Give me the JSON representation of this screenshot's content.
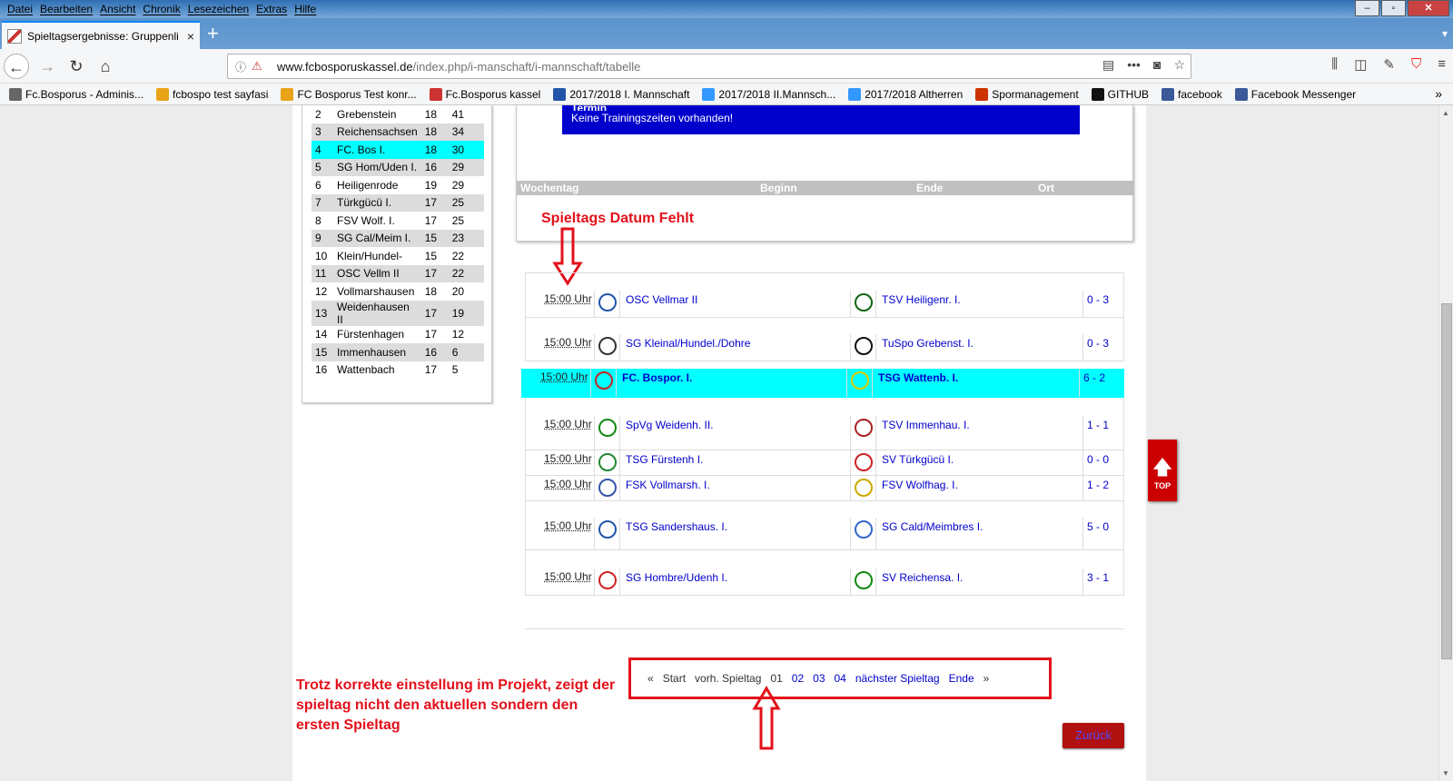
{
  "menubar": {
    "items": [
      "Datei",
      "Bearbeiten",
      "Ansicht",
      "Chronik",
      "Lesezeichen",
      "Extras",
      "Hilfe"
    ]
  },
  "tab": {
    "title": "Spieltagsergebnisse: Gruppenli",
    "close": "×",
    "new": "+"
  },
  "navbar": {
    "url_host": "www.fcbosporuskassel.de",
    "url_path": "/index.php/i-manschaft/i-mannschaft/tabelle"
  },
  "bookmarks": [
    {
      "label": "Fc.Bosporus - Adminis...",
      "color": "#666666"
    },
    {
      "label": "fcbospo test sayfasi",
      "color": "#e8a317"
    },
    {
      "label": "FC Bosporus Test konr...",
      "color": "#e8a317"
    },
    {
      "label": "Fc.Bosporus kassel",
      "color": "#cc3333"
    },
    {
      "label": "2017/2018 I. Mannschaft",
      "color": "#2255aa"
    },
    {
      "label": "2017/2018 II.Mannsch...",
      "color": "#3399ff"
    },
    {
      "label": "2017/2018 Altherren",
      "color": "#3399ff"
    },
    {
      "label": "Spormanagement",
      "color": "#cc3300"
    },
    {
      "label": "GITHUB",
      "color": "#111111"
    },
    {
      "label": "facebook",
      "color": "#3b5998"
    },
    {
      "label": "Facebook Messenger",
      "color": "#3b5998"
    }
  ],
  "standings": [
    {
      "rank": "2",
      "team": "Grebenstein",
      "games": "18",
      "points": "41"
    },
    {
      "rank": "3",
      "team": "Reichensachsen",
      "games": "18",
      "points": "34"
    },
    {
      "rank": "4",
      "team": "FC. Bos I.",
      "games": "18",
      "points": "30"
    },
    {
      "rank": "5",
      "team": "SG Hom/Uden I.",
      "games": "16",
      "points": "29"
    },
    {
      "rank": "6",
      "team": "Heiligenrode",
      "games": "19",
      "points": "29"
    },
    {
      "rank": "7",
      "team": "Türkgücü I.",
      "games": "17",
      "points": "25"
    },
    {
      "rank": "8",
      "team": "FSV Wolf. I.",
      "games": "17",
      "points": "25"
    },
    {
      "rank": "9",
      "team": "SG Cal/Meim I.",
      "games": "15",
      "points": "23"
    },
    {
      "rank": "10",
      "team": "Klein/Hundel-",
      "games": "15",
      "points": "22"
    },
    {
      "rank": "11",
      "team": "OSC Vellm II",
      "games": "17",
      "points": "22"
    },
    {
      "rank": "12",
      "team": "Vollmarshausen",
      "games": "18",
      "points": "20"
    },
    {
      "rank": "13",
      "team": "Weidenhausen II",
      "games": "17",
      "points": "19"
    },
    {
      "rank": "14",
      "team": "Fürstenhagen",
      "games": "17",
      "points": "12"
    },
    {
      "rank": "15",
      "team": "Immenhausen",
      "games": "16",
      "points": "6"
    },
    {
      "rank": "16",
      "team": "Wattenbach",
      "games": "17",
      "points": "5"
    }
  ],
  "training": {
    "title_partial": "Termin",
    "message": "Keine Trainingszeiten vorhanden!",
    "headers": {
      "day": "Wochentag",
      "start": "Beginn",
      "end": "Ende",
      "place": "Ort"
    }
  },
  "annotations": {
    "date_missing": "Spieltags Datum Fehlt",
    "note": "Trotz korrekte einstellung im Projekt, zeigt der spieltag nicht den aktuellen sondern den ersten Spieltag"
  },
  "matches": [
    {
      "time": "15:00 Uhr",
      "home": "OSC Vellmar II",
      "away": "TSV Heiligenr. I.",
      "score": "0 - 3",
      "home_color": "#2255aa",
      "away_color": "#116611"
    },
    {
      "time": "15:00 Uhr",
      "home": "SG Kleinal/Hundel./Dohre",
      "away": "TuSpo Grebenst. I.",
      "score": "0 - 3",
      "home_color": "#333333",
      "away_color": "#111111"
    },
    {
      "time": "15:00 Uhr",
      "home": "FC. Bospor. I.",
      "away": "TSG Wattenb. I.",
      "score": "6 - 2",
      "home_color": "#cc2222",
      "away_color": "#ddcc00"
    },
    {
      "time": "15:00 Uhr",
      "home": "SpVg Weidenh. II.",
      "away": "TSV Immenhau. I.",
      "score": "1 - 1",
      "home_color": "#118811",
      "away_color": "#aa2222"
    },
    {
      "time": "15:00 Uhr",
      "home": "TSG Fürstenh I.",
      "away": "SV Türkgücü I.",
      "score": "0 - 0",
      "home_color": "#228833",
      "away_color": "#cc2222"
    },
    {
      "time": "15:00 Uhr",
      "home": "FSK Vollmarsh. I.",
      "away": "FSV Wolfhag. I.",
      "score": "1 - 2",
      "home_color": "#3355aa",
      "away_color": "#ccaa00"
    },
    {
      "time": "15:00 Uhr",
      "home": "TSG Sandershaus. I.",
      "away": "SG Cald/Meimbres I.",
      "score": "5 - 0",
      "home_color": "#2255aa",
      "away_color": "#3366cc"
    },
    {
      "time": "15:00 Uhr",
      "home": "SG Hombre/Udenh I.",
      "away": "SV Reichensa. I.",
      "score": "3 - 1",
      "home_color": "#cc2222",
      "away_color": "#118811"
    }
  ],
  "pager": {
    "first_sym": "«",
    "start": "Start",
    "prev": "vorh. Spieltag",
    "pages": [
      "01",
      "02",
      "03",
      "04"
    ],
    "next": "nächster Spieltag",
    "end": "Ende",
    "last_sym": "»"
  },
  "buttons": {
    "back": "Zurück",
    "top": "TOP"
  },
  "colors": {
    "highlight": "#00ffff",
    "annotation": "#e3101a",
    "link": "#0000cc",
    "top_button": "#cc0000"
  }
}
